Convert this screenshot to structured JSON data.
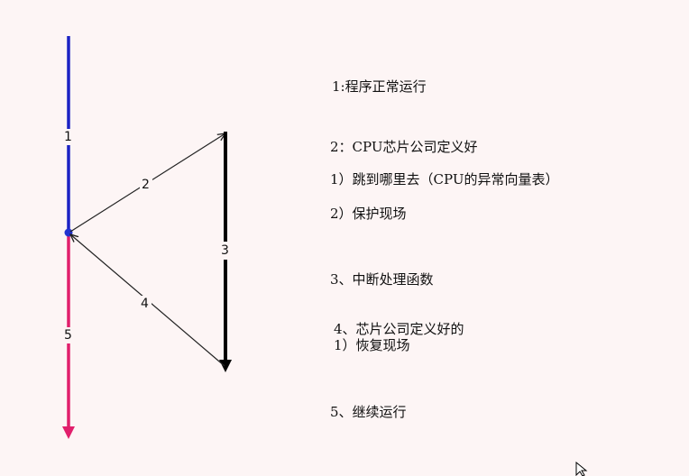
{
  "colors": {
    "background": "#fdf5f5",
    "step1_line": "#1b22c4",
    "step5_line": "#e11f6c",
    "step3_line": "#000000",
    "arrow_line": "#222222",
    "junction_dot": "#2233d0"
  },
  "diagram": {
    "step_numbers": {
      "s1": "1",
      "s2": "2",
      "s3": "3",
      "s4": "4",
      "s5": "5"
    }
  },
  "notes": {
    "n1": "1:程序正常运行",
    "n2_title": "2：CPU芯片公司定义好",
    "n2_sub1": "1）跳到哪里去（CPU的异常向量表）",
    "n2_sub2": "2）保护现场",
    "n3": "3、中断处理函数",
    "n4_title": "4、芯片公司定义好的",
    "n4_sub1": "1）恢复现场",
    "n5": "5、继续运行"
  },
  "icons": {
    "cursor": "mouse-pointer-icon"
  }
}
